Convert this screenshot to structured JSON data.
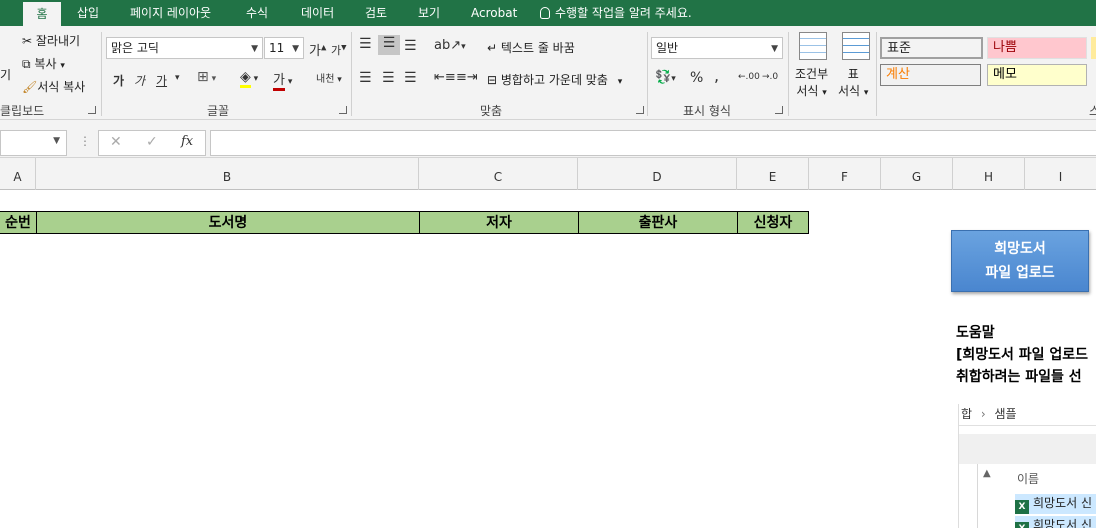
{
  "tabs": [
    {
      "label": "홈",
      "active": true
    },
    {
      "label": "삽입"
    },
    {
      "label": "페이지 레이아웃"
    },
    {
      "label": "수식"
    },
    {
      "label": "데이터"
    },
    {
      "label": "검토"
    },
    {
      "label": "보기"
    },
    {
      "label": "Acrobat"
    }
  ],
  "tell_me": "수행할 작업을 알려 주세요.",
  "clipboard": {
    "paste_fragment": "기",
    "cut": "잘라내기",
    "copy": "복사",
    "format_painter": "서식 복사",
    "group_label": "클립보드"
  },
  "font": {
    "name": "맑은 고딕",
    "size": "11",
    "bold": "가",
    "italic": "가",
    "underline": "가",
    "font_color_glyph": "가",
    "phonetic_glyph": "내천",
    "group_label": "글꼴"
  },
  "alignment": {
    "wrap_text": "텍스트 줄 바꿈",
    "merge_center": "병합하고 가운데 맞춤",
    "group_label": "맞춤"
  },
  "number": {
    "format": "일반",
    "percent": "%",
    "comma": ",",
    "inc_decimal": ".00",
    "dec_decimal": ".0",
    "group_label": "표시 형식"
  },
  "styles_group": {
    "conditional_line1": "조건부",
    "conditional_line2": "서식",
    "table_line1": "표",
    "table_line2": "서식",
    "styles": [
      {
        "label": "표준",
        "color": "#000000",
        "bg": "#ffffff"
      },
      {
        "label": "나쁨",
        "color": "#9c0006",
        "bg": "#ffc7ce"
      },
      {
        "label": "계산",
        "color": "#fa7d00",
        "bg": "#f2f2f2"
      },
      {
        "label": "메모",
        "color": "#000000",
        "bg": "#ffffcc"
      }
    ],
    "group_label_fragment": "스"
  },
  "formula_bar": {
    "cancel": "✕",
    "enter": "✓",
    "fx": "fx",
    "value": ""
  },
  "columns": [
    "A",
    "B",
    "C",
    "D",
    "E",
    "F",
    "G",
    "H",
    "I"
  ],
  "table_headers": [
    "순번",
    "도서명",
    "저자",
    "출판사",
    "신청자"
  ],
  "upload_button": {
    "line1": "희망도서",
    "line2": "파일 업로드"
  },
  "help": {
    "title": "도움말",
    "line1": "[희망도서 파일 업로드",
    "line2": "취합하려는 파일들 선"
  },
  "explorer": {
    "path_a": "합",
    "path_b": "샘플",
    "column_name": "이름",
    "files": [
      "희망도서 신",
      "희망도서 신"
    ]
  },
  "colors": {
    "tab_bar": "#217346",
    "header_fill": "#a9d08e",
    "upload_button": "#5b9bd5"
  }
}
